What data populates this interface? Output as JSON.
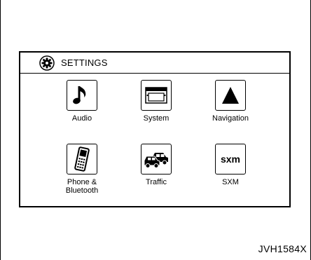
{
  "header": {
    "title": "SETTINGS",
    "icon": "gear-icon"
  },
  "tiles": [
    {
      "label": "Audio",
      "icon": "music-note-icon"
    },
    {
      "label": "System",
      "icon": "display-screen-icon"
    },
    {
      "label": "Navigation",
      "icon": "navigation-arrow-icon"
    },
    {
      "label": "Phone &\nBluetooth",
      "icon": "mobile-phone-icon"
    },
    {
      "label": "Traffic",
      "icon": "traffic-cars-icon"
    },
    {
      "label": "SXM",
      "icon": "sxm-logo-icon",
      "icon_text": "sxm"
    }
  ],
  "figure_code": "JVH1584X"
}
